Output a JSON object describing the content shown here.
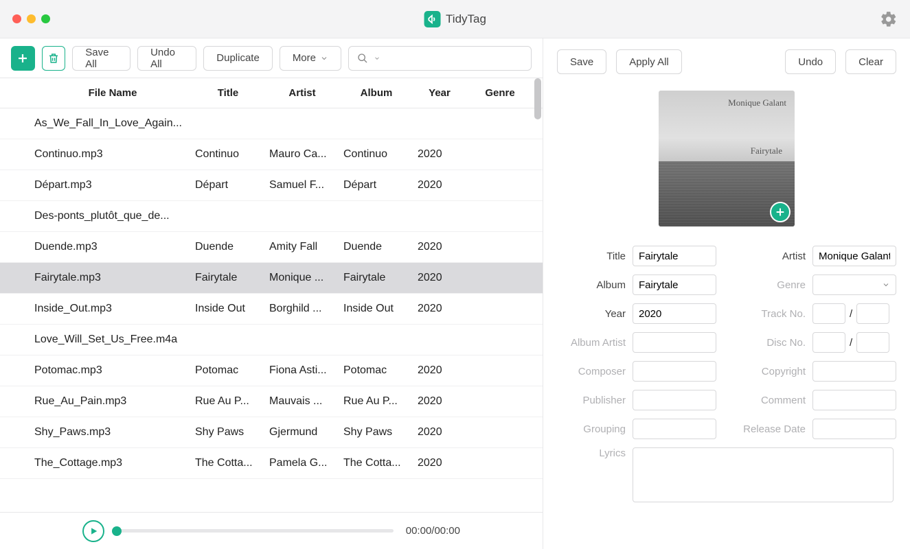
{
  "app": {
    "title": "TidyTag"
  },
  "toolbar": {
    "save_all": "Save All",
    "undo_all": "Undo All",
    "duplicate": "Duplicate",
    "more": "More"
  },
  "search": {
    "value": ""
  },
  "table": {
    "headers": {
      "file_name": "File Name",
      "title": "Title",
      "artist": "Artist",
      "album": "Album",
      "year": "Year",
      "genre": "Genre"
    },
    "rows": [
      {
        "file": "As_We_Fall_In_Love_Again...",
        "title": "",
        "artist": "",
        "album": "",
        "year": "",
        "genre": ""
      },
      {
        "file": "Continuo.mp3",
        "title": "Continuo",
        "artist": "Mauro Ca...",
        "album": "Continuo",
        "year": "2020",
        "genre": ""
      },
      {
        "file": "Départ.mp3",
        "title": "Départ",
        "artist": "Samuel F...",
        "album": "Départ",
        "year": "2020",
        "genre": ""
      },
      {
        "file": "Des-ponts_plutôt_que_de...",
        "title": "",
        "artist": "",
        "album": "",
        "year": "",
        "genre": ""
      },
      {
        "file": "Duende.mp3",
        "title": "Duende",
        "artist": "Amity Fall",
        "album": "Duende",
        "year": "2020",
        "genre": ""
      },
      {
        "file": "Fairytale.mp3",
        "title": "Fairytale",
        "artist": "Monique ...",
        "album": "Fairytale",
        "year": "2020",
        "genre": ""
      },
      {
        "file": "Inside_Out.mp3",
        "title": "Inside Out",
        "artist": "Borghild ...",
        "album": "Inside Out",
        "year": "2020",
        "genre": ""
      },
      {
        "file": "Love_Will_Set_Us_Free.m4a",
        "title": "",
        "artist": "",
        "album": "",
        "year": "",
        "genre": ""
      },
      {
        "file": "Potomac.mp3",
        "title": "Potomac",
        "artist": "Fiona Asti...",
        "album": "Potomac",
        "year": "2020",
        "genre": ""
      },
      {
        "file": "Rue_Au_Pain.mp3",
        "title": "Rue Au P...",
        "artist": "Mauvais ...",
        "album": "Rue Au P...",
        "year": "2020",
        "genre": ""
      },
      {
        "file": "Shy_Paws.mp3",
        "title": "Shy Paws",
        "artist": "Gjermund",
        "album": "Shy Paws",
        "year": "2020",
        "genre": ""
      },
      {
        "file": "The_Cottage.mp3",
        "title": "The Cotta...",
        "artist": "Pamela G...",
        "album": "The Cotta...",
        "year": "2020",
        "genre": ""
      }
    ],
    "selected_index": 5
  },
  "player": {
    "time": "00:00/00:00"
  },
  "detail": {
    "buttons": {
      "save": "Save",
      "apply_all": "Apply All",
      "undo": "Undo",
      "clear": "Clear"
    },
    "labels": {
      "title": "Title",
      "artist": "Artist",
      "album": "Album",
      "genre": "Genre",
      "year": "Year",
      "track_no": "Track No.",
      "album_artist": "Album Artist",
      "disc_no": "Disc No.",
      "composer": "Composer",
      "copyright": "Copyright",
      "publisher": "Publisher",
      "comment": "Comment",
      "grouping": "Grouping",
      "release_date": "Release Date",
      "lyrics": "Lyrics"
    },
    "values": {
      "title": "Fairytale",
      "artist": "Monique Galant",
      "album": "Fairytale",
      "genre": "",
      "year": "2020",
      "track_a": "",
      "track_b": "",
      "album_artist": "",
      "disc_a": "",
      "disc_b": "",
      "composer": "",
      "copyright": "",
      "publisher": "",
      "comment": "",
      "grouping": "",
      "release_date": "",
      "lyrics": ""
    },
    "art_text": {
      "line1": "Monique Galant",
      "line2": "Fairytale"
    },
    "slash": "/"
  }
}
